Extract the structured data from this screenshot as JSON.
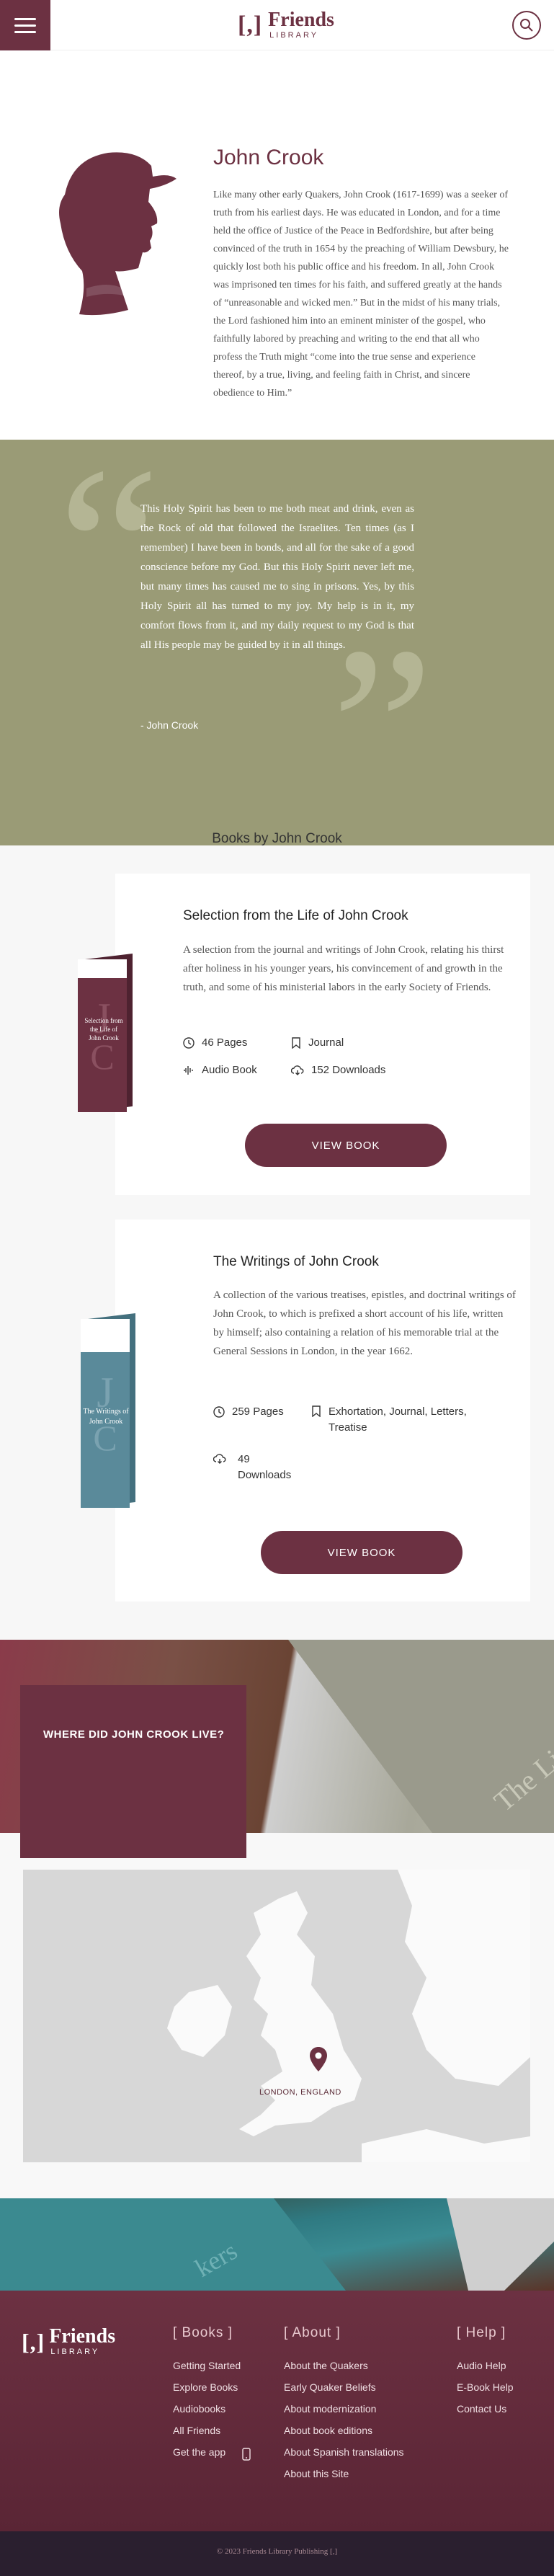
{
  "header": {
    "logo_mark": "[,]",
    "logo_title": "Friends",
    "logo_sub": "LIBRARY"
  },
  "bio": {
    "name": "John Crook",
    "text": "Like many other early Quakers, John Crook (1617-1699) was a seeker of truth from his earliest days. He was educated in London, and for a time held the office of Justice of the Peace in Bedfordshire, but after being convinced of the truth in 1654 by the preaching of William Dewsbury, he quickly lost both his public office and his freedom. In all, John Crook was imprisoned ten times for his faith, and suffered greatly at the hands of “unreasonable and wicked men.” But in the midst of his many trials, the Lord fashioned him into an eminent minister of the gospel, who faithfully labored by preaching and writing to the end that all who profess the Truth might “come into the true sense and experience thereof, by a true, living, and feeling faith in Christ, and sincere obedience to Him.”"
  },
  "quote": {
    "text": "This Holy Spirit has been to me both meat and drink, even as the Rock of old that followed the Israelites. Ten times (as I remember) I have been in bonds, and all for the sake of a good conscience before my God. But this Holy Spirit never left me, but many times has caused me to sing in prisons. Yes, by this Holy Spirit all has turned to my joy. My help is in it, my comfort flows from it, and my daily request to my God is that all His people may be guided by it in all things.",
    "author": "- John Crook"
  },
  "books": {
    "heading": "Books by John Crook",
    "items": [
      {
        "title": "Selection from the Life of John Crook",
        "description": "A selection from the journal and writings of John Crook, relating his thirst after holiness in his younger years, his convincement of and growth in the truth, and some of his ministerial labors in the early Society of Friends.",
        "pages": "46 Pages",
        "tags": "Journal",
        "audio": "Audio Book",
        "downloads": "152 Downloads",
        "button": "VIEW BOOK",
        "cover_color": "#6c3142",
        "cover_title_1": "Selection from",
        "cover_title_2": "the Life of",
        "cover_title_3": "John Crook"
      },
      {
        "title": "The Writings of John Crook",
        "description": "A collection of the various treatises, epistles, and doctrinal writings of John Crook, to which is prefixed a short account of his life, written by himself; also containing a relation of his memorable trial at the General Sessions in London, in the year 1662.",
        "pages": "259 Pages",
        "tags_1": "Exhortation, Journal, Letters,",
        "tags_2": "Treatise",
        "downloads_1": "49",
        "downloads_2": "Downloads",
        "button": "VIEW BOOK",
        "cover_color": "#5a8a9a",
        "cover_title_1": "The Writings of",
        "cover_title_2": "John Crook"
      }
    ]
  },
  "map": {
    "heading": "WHERE DID JOHN CROOK LIVE?",
    "location": "LONDON, ENGLAND"
  },
  "footer": {
    "logo_title": "Friends",
    "logo_sub": "LIBRARY",
    "books_title": "[ Books ]",
    "books_links": [
      "Getting Started",
      "Explore Books",
      "Audiobooks",
      "All Friends",
      "Get the app"
    ],
    "about_title": "[ About ]",
    "about_links": [
      "About the Quakers",
      "Early Quaker Beliefs",
      "About modernization",
      "About book editions",
      "About Spanish translations",
      "About this Site"
    ],
    "help_title": "[ Help ]",
    "help_links": [
      "Audio Help",
      "E-Book Help",
      "Contact Us"
    ],
    "copyright": "© 2023 Friends Library Publishing [,]"
  }
}
